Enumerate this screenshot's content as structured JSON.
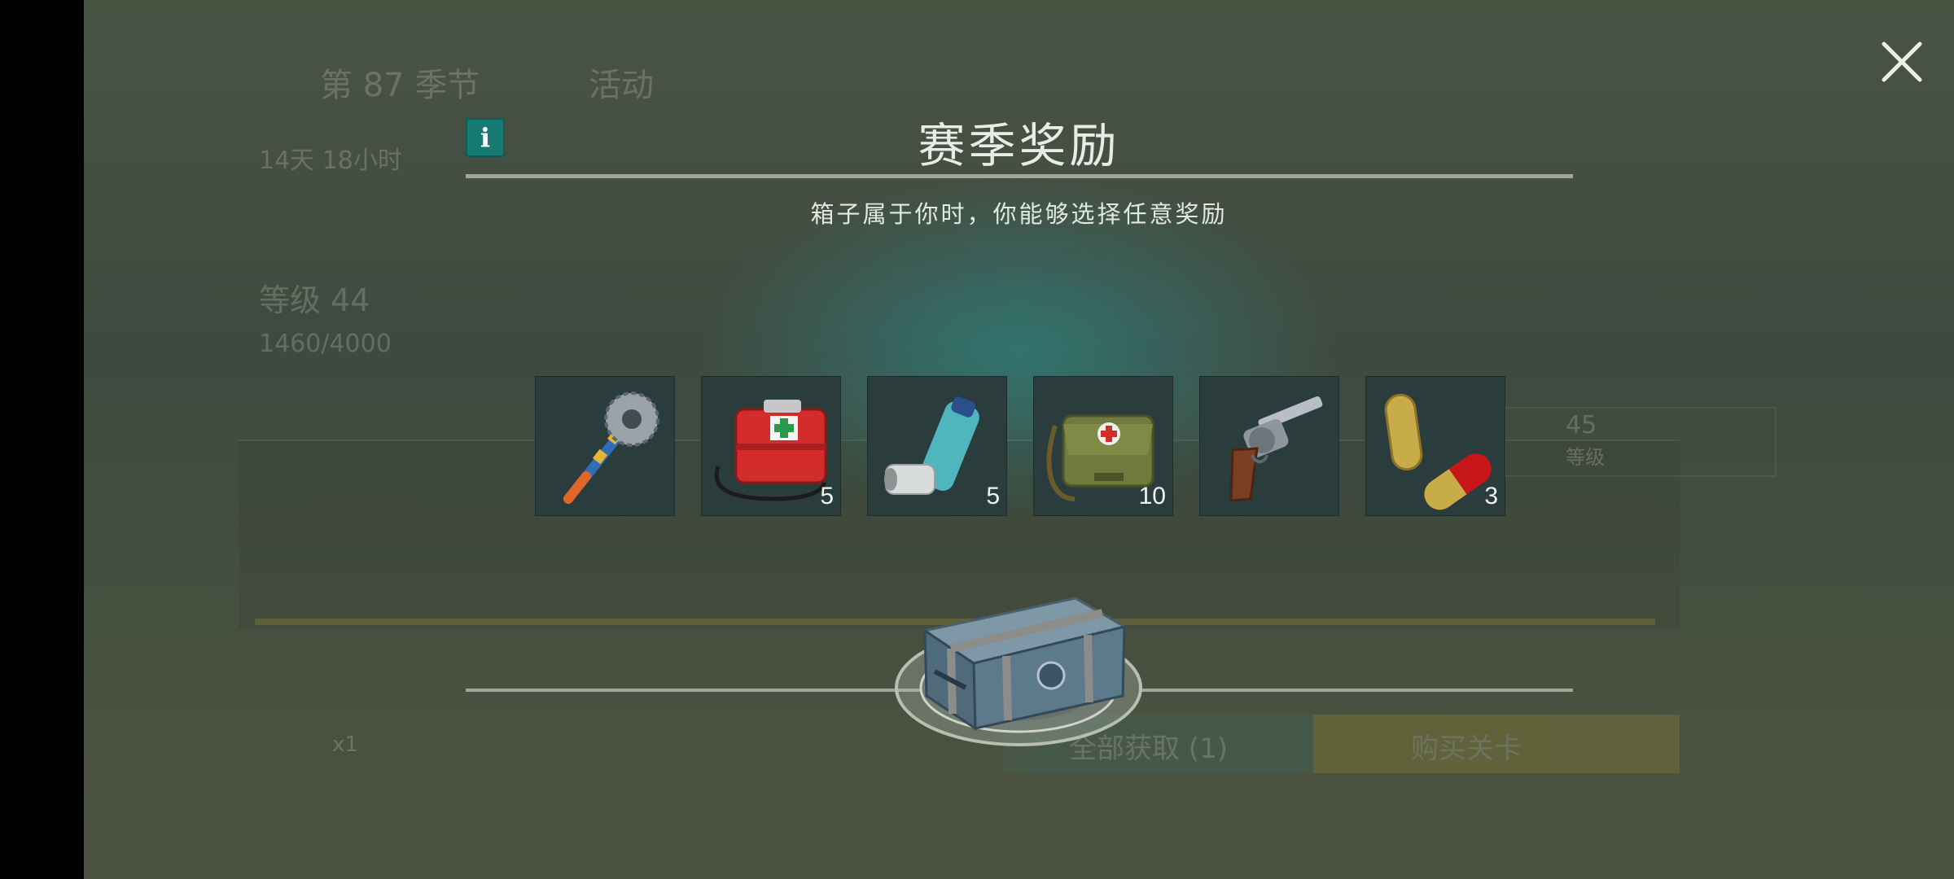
{
  "background": {
    "tab_season": "第 87 季节",
    "tab_event": "活动",
    "timer": "14天 18小时",
    "level": "等级 44",
    "xp": "1460/4000",
    "level_45_num": "45",
    "level_45_label": "等级",
    "claim_all": "全部获取 (1)",
    "buy_pass": "购买关卡",
    "box_count": "x1"
  },
  "modal": {
    "title": "赛季奖励",
    "subtitle": "箱子属于你时，你能够选择任意奖励",
    "info_label": "i",
    "rewards": [
      {
        "name": "saw-mace",
        "quantity": ""
      },
      {
        "name": "first-aid-kit",
        "quantity": "5"
      },
      {
        "name": "inhaler",
        "quantity": "5"
      },
      {
        "name": "medical-bag",
        "quantity": "10"
      },
      {
        "name": "revolver",
        "quantity": ""
      },
      {
        "name": "pills",
        "quantity": "3"
      }
    ]
  },
  "colors": {
    "accent_teal": "#177a72",
    "tile_bg": "#2a3c3c",
    "gold": "#b59a2c"
  }
}
